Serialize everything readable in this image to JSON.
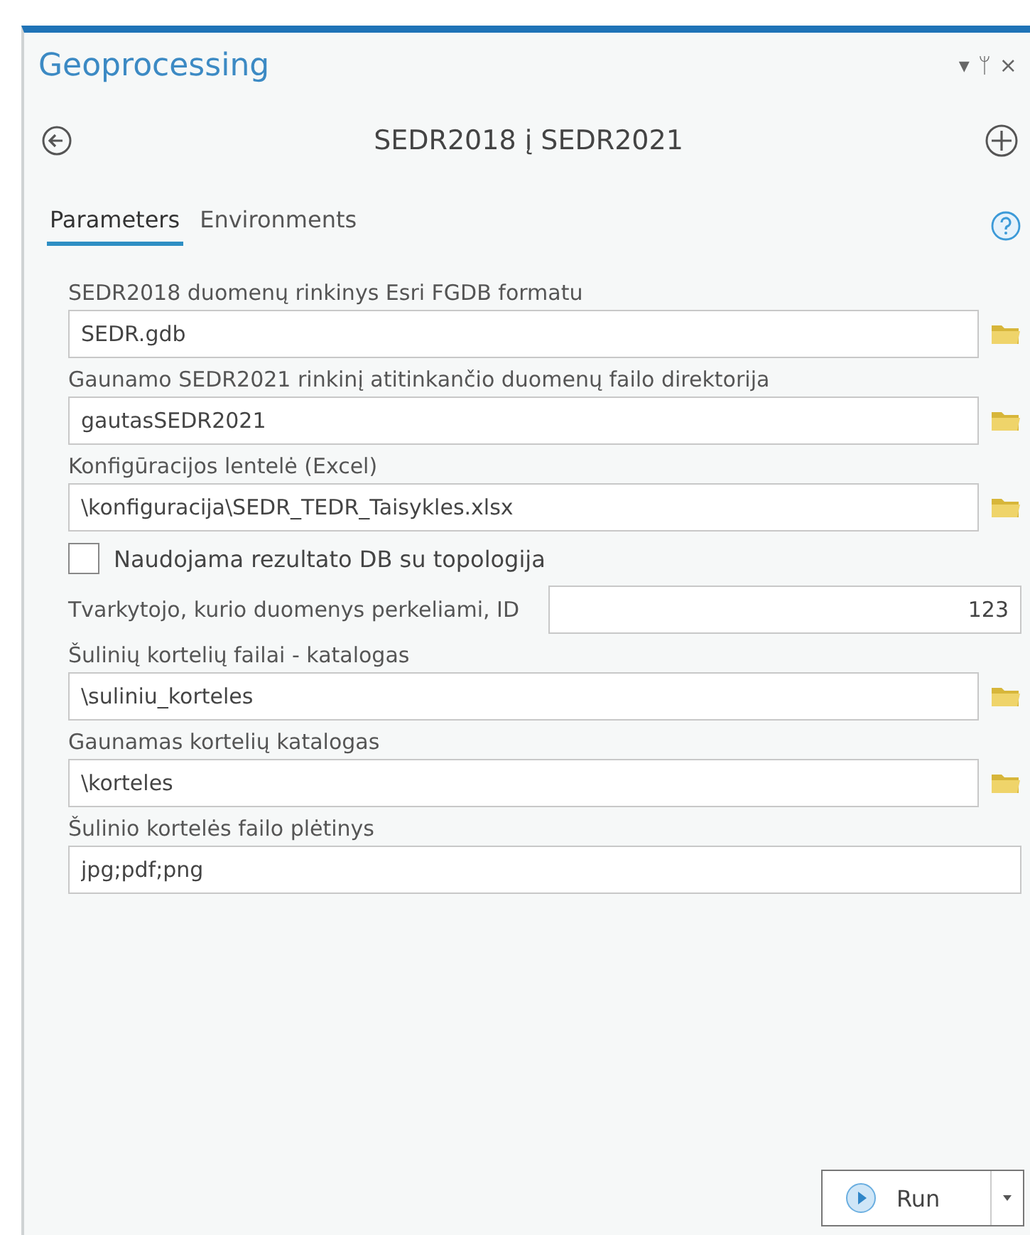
{
  "pane": {
    "title": "Geoprocessing",
    "controls": [
      "▾",
      "ᛘ",
      "×"
    ]
  },
  "tool": {
    "title": "SEDR2018 į SEDR2021"
  },
  "tabs": [
    {
      "label": "Parameters",
      "selected": true
    },
    {
      "label": "Environments",
      "selected": false
    }
  ],
  "parameters": [
    {
      "kind": "path",
      "label": "SEDR2018 duomenų rinkinys Esri FGDB formatu",
      "value": "SEDR.gdb"
    },
    {
      "kind": "path",
      "label": "Gaunamo SEDR2021 rinkinį atitinkančio duomenų failo direktorija",
      "value": "gautasSEDR2021"
    },
    {
      "kind": "path",
      "label": "Konfigūracijos lentelė (Excel)",
      "value": "\\konfiguracija\\SEDR_TEDR_Taisykles.xlsx"
    },
    {
      "kind": "checkbox",
      "label": "Naudojama rezultato DB su topologija",
      "checked": false
    },
    {
      "kind": "inline",
      "label": "Tvarkytojo, kurio duomenys perkeliami, ID",
      "value": "123"
    },
    {
      "kind": "path",
      "label": "Šulinių kortelių failai - katalogas",
      "value": "\\suliniu_korteles"
    },
    {
      "kind": "path",
      "label": "Gaunamas kortelių katalogas",
      "value": "\\korteles"
    },
    {
      "kind": "text",
      "label": "Šulinio kortelės failo plėtinys",
      "value": "jpg;pdf;png"
    }
  ],
  "run_button": {
    "label": "Run"
  }
}
